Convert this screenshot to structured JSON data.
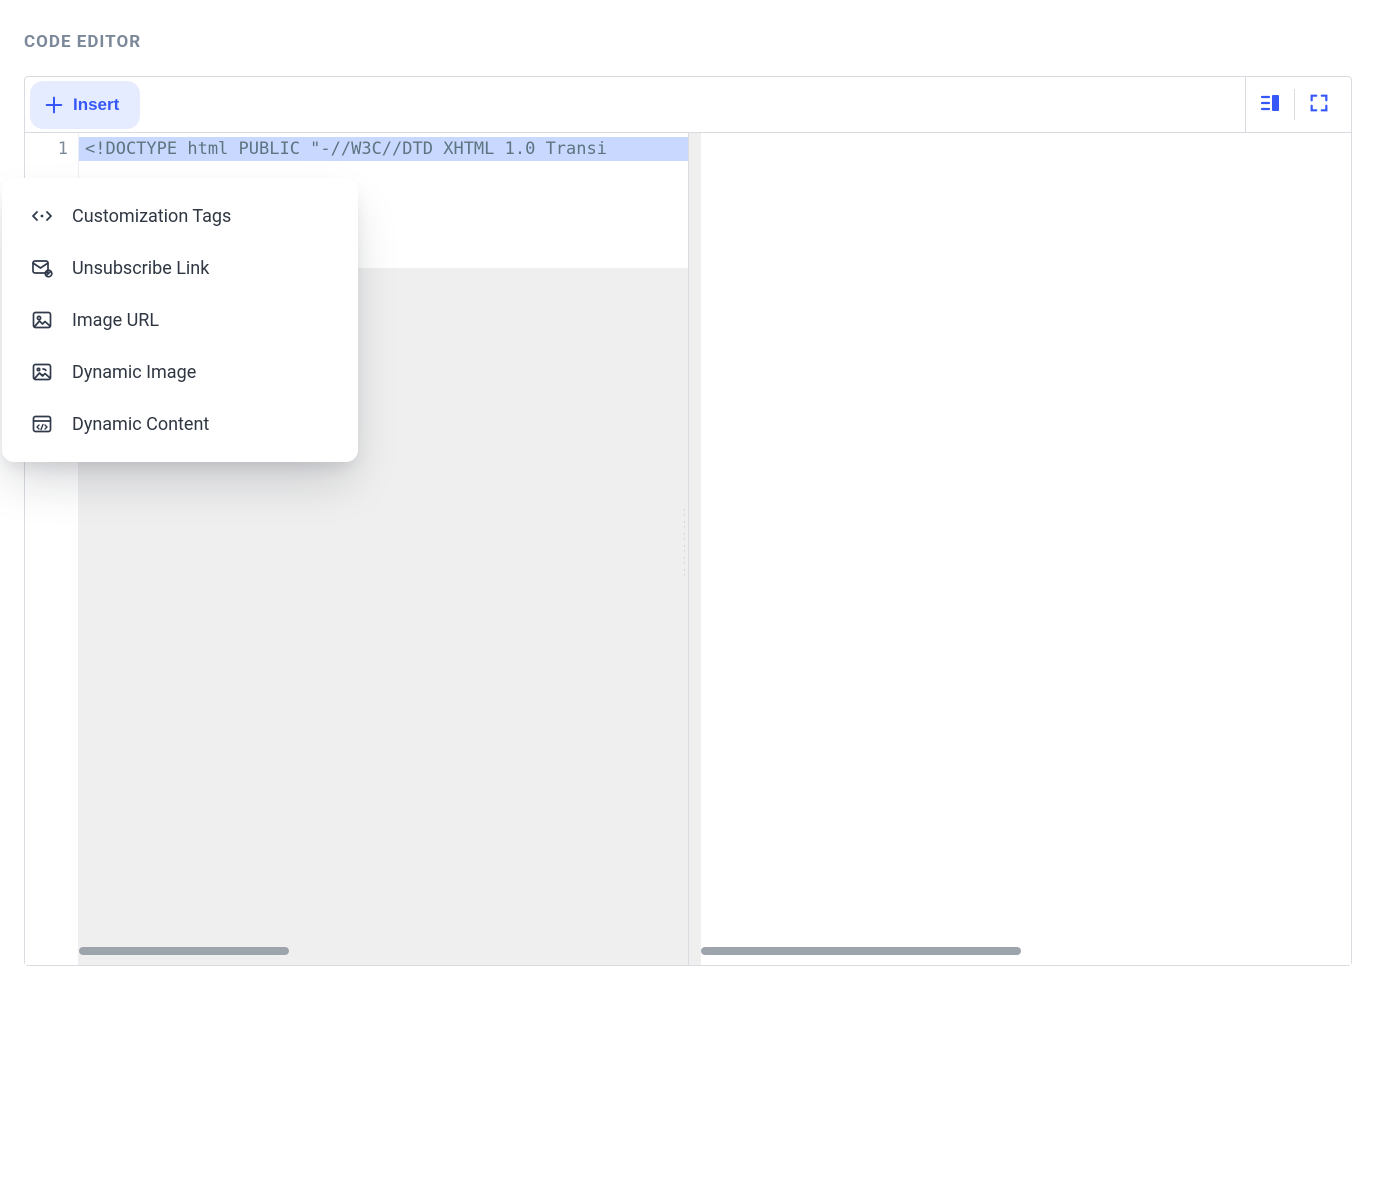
{
  "header": {
    "title": "CODE EDITOR"
  },
  "toolbar": {
    "insert_label": "Insert"
  },
  "code": {
    "line_number": "1",
    "line_1": "<!DOCTYPE html PUBLIC \"-//W3C//DTD XHTML 1.0 Transi"
  },
  "insert_menu": {
    "items": [
      {
        "label": "Customization Tags"
      },
      {
        "label": "Unsubscribe Link"
      },
      {
        "label": "Image URL"
      },
      {
        "label": "Dynamic Image"
      },
      {
        "label": "Dynamic Content"
      }
    ]
  }
}
